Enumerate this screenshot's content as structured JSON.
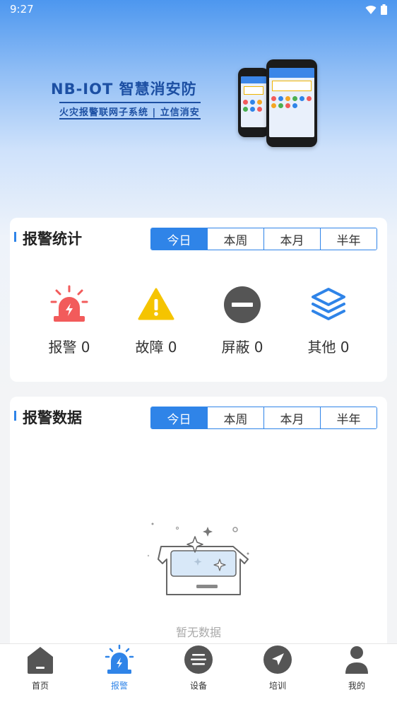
{
  "status_bar": {
    "time": "9:27"
  },
  "banner": {
    "title": "NB-IOT 智慧消安防",
    "subtitle": "火灾报警联网子系统 | 立信消安"
  },
  "alarm_stats": {
    "title": "报警统计",
    "tabs": [
      "今日",
      "本周",
      "本月",
      "半年"
    ],
    "active_tab": "今日",
    "items": [
      {
        "label": "报警 0",
        "icon": "siren-icon",
        "color": "#f25b5b"
      },
      {
        "label": "故障 0",
        "icon": "warning-icon",
        "color": "#f5c400"
      },
      {
        "label": "屏蔽 0",
        "icon": "block-icon",
        "color": "#555555"
      },
      {
        "label": "其他 0",
        "icon": "layers-icon",
        "color": "#2f84e8"
      }
    ]
  },
  "alarm_data": {
    "title": "报警数据",
    "tabs": [
      "今日",
      "本周",
      "本月",
      "半年"
    ],
    "active_tab": "今日",
    "empty_text": "暂无数据"
  },
  "tab_bar": {
    "items": [
      {
        "label": "首页",
        "icon": "home-icon"
      },
      {
        "label": "报警",
        "icon": "alarm-icon",
        "active": true
      },
      {
        "label": "设备",
        "icon": "device-icon"
      },
      {
        "label": "培训",
        "icon": "navigation-icon"
      },
      {
        "label": "我的",
        "icon": "user-icon"
      }
    ]
  },
  "colors": {
    "accent": "#2f84e8",
    "inactive_icon": "#555555"
  }
}
